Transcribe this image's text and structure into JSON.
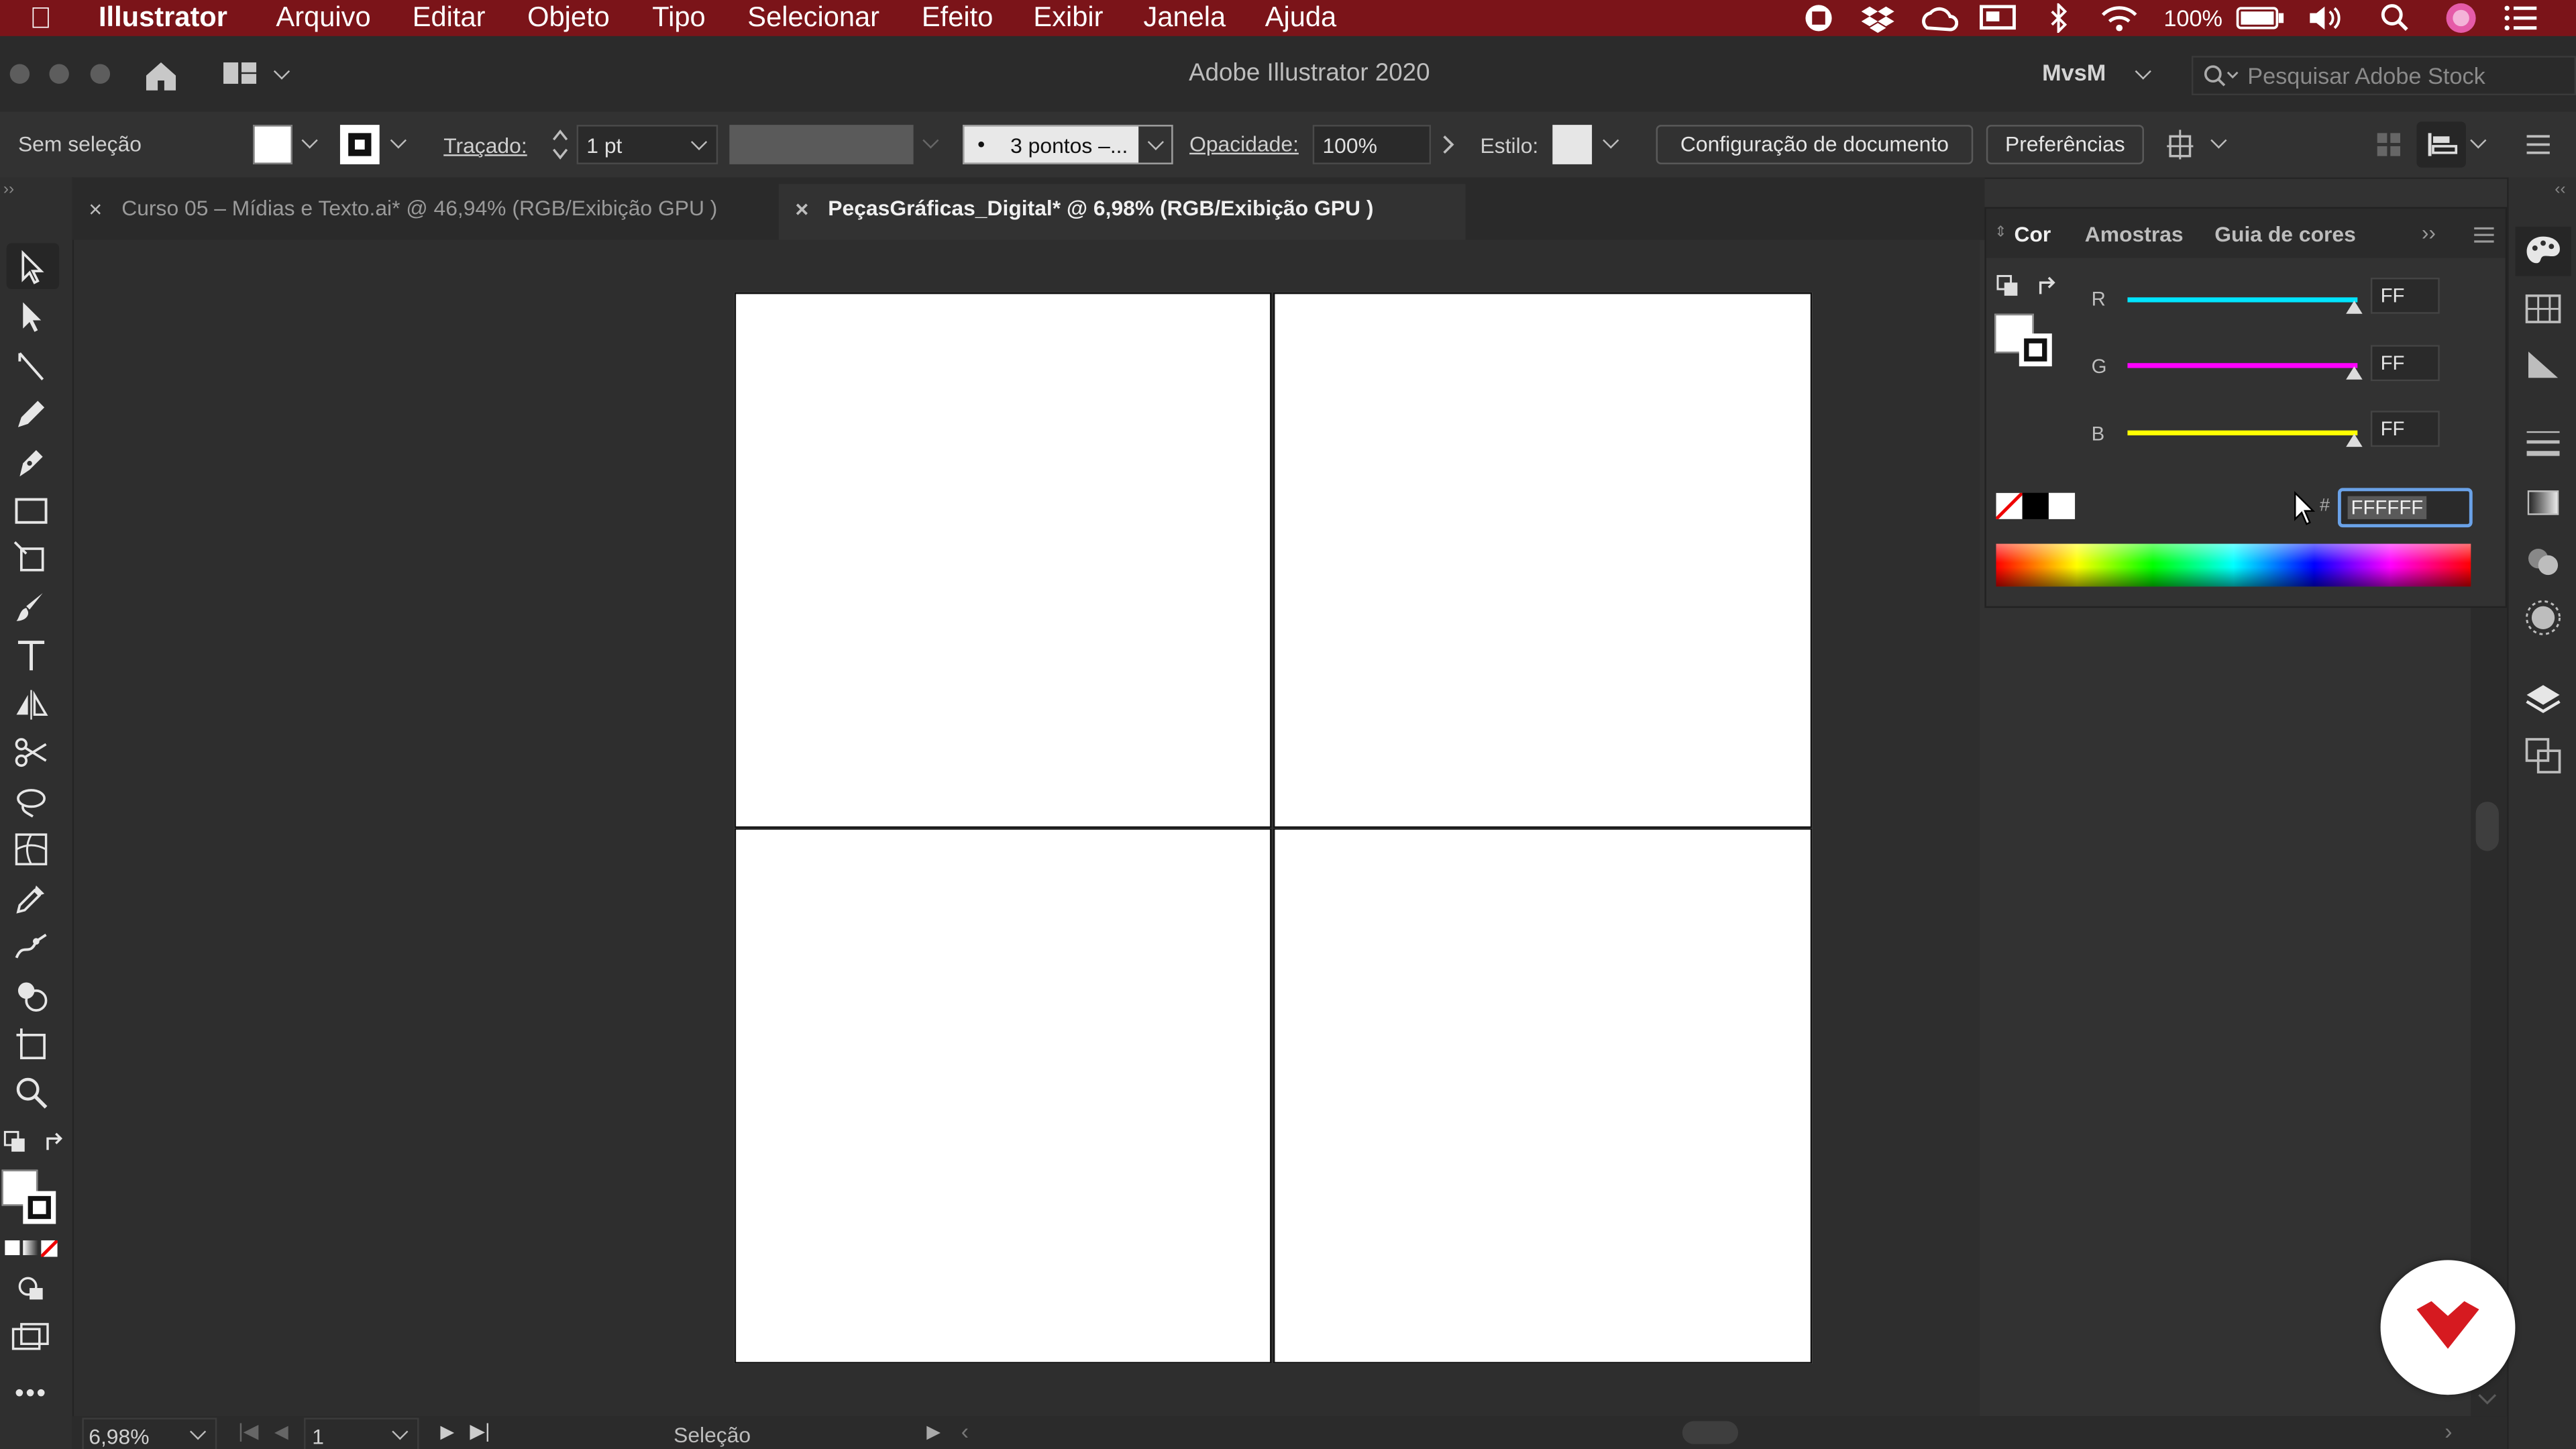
{
  "menubar": {
    "app_name": "Illustrator",
    "items": [
      "Arquivo",
      "Editar",
      "Objeto",
      "Tipo",
      "Selecionar",
      "Efeito",
      "Exibir",
      "Janela",
      "Ajuda"
    ],
    "battery": "100%",
    "color": "#7b1419"
  },
  "window": {
    "title": "Adobe Illustrator 2020",
    "workspace": "MvsM",
    "search_placeholder": "Pesquisar Adobe Stock"
  },
  "control_bar": {
    "selection_status": "Sem seleção",
    "stroke_label": "Traçado:",
    "stroke_weight": "1 pt",
    "brush_profile": "3 pontos –...",
    "opacity_label": "Opacidade:",
    "opacity_value": "100%",
    "style_label": "Estilo:",
    "doc_setup_button": "Configuração de documento",
    "preferences_button": "Preferências"
  },
  "tabs": [
    {
      "label": "Curso 05 – Mídias e Texto.ai* @ 46,94% (RGB/Exibição GPU )",
      "active": false
    },
    {
      "label": "PeçasGráficas_Digital* @ 6,98% (RGB/Exibição GPU )",
      "active": true
    }
  ],
  "tools": [
    "selection-tool-icon",
    "direct-selection-tool-icon",
    "line-tool-icon",
    "pencil-tool-icon",
    "pen-tool-icon",
    "rectangle-tool-icon",
    "free-transform-tool-icon",
    "paintbrush-tool-icon",
    "type-tool-icon",
    "reflect-tool-icon",
    "scissors-tool-icon",
    "lasso-tool-icon",
    "mesh-tool-icon",
    "eyedropper-tool-icon",
    "puppet-warp-tool-icon",
    "shape-builder-tool-icon",
    "artboard-tool-icon",
    "zoom-tool-icon"
  ],
  "color_panel": {
    "tabs": [
      "Cor",
      "Amostras",
      "Guia de cores"
    ],
    "channels": [
      {
        "label": "R",
        "value": "FF",
        "color": "#00e5ff"
      },
      {
        "label": "G",
        "value": "FF",
        "color": "#ff00ff"
      },
      {
        "label": "B",
        "value": "FF",
        "color": "#ffff00"
      }
    ],
    "hex_symbol": "#",
    "hex_value": "FFFFFF",
    "fill_color": "#FFFFFF"
  },
  "status_bar": {
    "zoom": "6,98%",
    "artboard_number": "1",
    "tool_name": "Seleção"
  },
  "brand_badge_color": "#d61a20"
}
